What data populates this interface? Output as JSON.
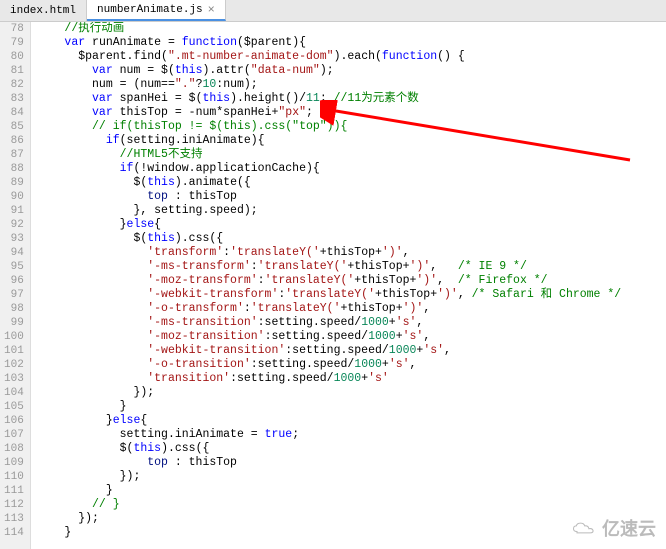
{
  "tabs": {
    "items": [
      {
        "name": "index.html",
        "active": false
      },
      {
        "name": "numberAnimate.js",
        "active": true
      }
    ],
    "close_glyph": "×"
  },
  "line_start": 78,
  "line_end": 114,
  "code_lines": [
    {
      "indent": 2,
      "tokens": [
        [
          "comment",
          "//执行动画"
        ]
      ]
    },
    {
      "indent": 2,
      "tokens": [
        [
          "keyword",
          "var"
        ],
        [
          "ident",
          " runAnimate = "
        ],
        [
          "keyword",
          "function"
        ],
        [
          "punct",
          "($parent){"
        ]
      ]
    },
    {
      "indent": 3,
      "tokens": [
        [
          "ident",
          "$parent.find("
        ],
        [
          "string",
          "\".mt-number-animate-dom\""
        ],
        [
          "punct",
          ").each("
        ],
        [
          "keyword",
          "function"
        ],
        [
          "punct",
          "() {"
        ]
      ]
    },
    {
      "indent": 4,
      "tokens": [
        [
          "keyword",
          "var"
        ],
        [
          "ident",
          " num = $("
        ],
        [
          "keyword",
          "this"
        ],
        [
          "punct",
          ").attr("
        ],
        [
          "string",
          "\"data-num\""
        ],
        [
          "punct",
          ");"
        ]
      ]
    },
    {
      "indent": 4,
      "tokens": [
        [
          "ident",
          "num = (num=="
        ],
        [
          "string",
          "\".\""
        ],
        [
          "punct",
          "?"
        ],
        [
          "number",
          "10"
        ],
        [
          "punct",
          ":num);"
        ]
      ]
    },
    {
      "indent": 4,
      "tokens": [
        [
          "keyword",
          "var"
        ],
        [
          "ident",
          " spanHei = $("
        ],
        [
          "keyword",
          "this"
        ],
        [
          "punct",
          ").height()/"
        ],
        [
          "number",
          "11"
        ],
        [
          "punct",
          "; "
        ],
        [
          "comment",
          "//11为元素个数"
        ]
      ]
    },
    {
      "indent": 4,
      "tokens": [
        [
          "keyword",
          "var"
        ],
        [
          "ident",
          " thisTop = -num*spanHei+"
        ],
        [
          "string",
          "\"px\""
        ],
        [
          "punct",
          ";"
        ]
      ]
    },
    {
      "indent": 4,
      "tokens": [
        [
          "comment",
          "// if(thisTop != $(this).css(\"top\")){"
        ]
      ]
    },
    {
      "indent": 5,
      "tokens": [
        [
          "keyword",
          "if"
        ],
        [
          "punct",
          "(setting.iniAnimate){"
        ]
      ]
    },
    {
      "indent": 6,
      "tokens": [
        [
          "comment",
          "//HTML5不支持"
        ]
      ]
    },
    {
      "indent": 6,
      "tokens": [
        [
          "keyword",
          "if"
        ],
        [
          "punct",
          "(!window.applicationCache){"
        ]
      ]
    },
    {
      "indent": 7,
      "tokens": [
        [
          "ident",
          "$("
        ],
        [
          "keyword",
          "this"
        ],
        [
          "punct",
          ").animate({"
        ]
      ]
    },
    {
      "indent": 8,
      "tokens": [
        [
          "prop",
          "top "
        ],
        [
          "punct",
          ": thisTop"
        ]
      ]
    },
    {
      "indent": 7,
      "tokens": [
        [
          "punct",
          "}, setting.speed);"
        ]
      ]
    },
    {
      "indent": 6,
      "tokens": [
        [
          "punct",
          "}"
        ],
        [
          "keyword",
          "else"
        ],
        [
          "punct",
          "{"
        ]
      ]
    },
    {
      "indent": 7,
      "tokens": [
        [
          "ident",
          "$("
        ],
        [
          "keyword",
          "this"
        ],
        [
          "punct",
          ").css({"
        ]
      ]
    },
    {
      "indent": 8,
      "tokens": [
        [
          "string",
          "'transform'"
        ],
        [
          "punct",
          ":"
        ],
        [
          "string",
          "'translateY('"
        ],
        [
          "punct",
          "+thisTop+"
        ],
        [
          "string",
          "')'"
        ],
        [
          "punct",
          ","
        ]
      ]
    },
    {
      "indent": 8,
      "tokens": [
        [
          "string",
          "'-ms-transform'"
        ],
        [
          "punct",
          ":"
        ],
        [
          "string",
          "'translateY('"
        ],
        [
          "punct",
          "+thisTop+"
        ],
        [
          "string",
          "')'"
        ],
        [
          "punct",
          ",   "
        ],
        [
          "comment",
          "/* IE 9 */"
        ]
      ]
    },
    {
      "indent": 8,
      "tokens": [
        [
          "string",
          "'-moz-transform'"
        ],
        [
          "punct",
          ":"
        ],
        [
          "string",
          "'translateY('"
        ],
        [
          "punct",
          "+thisTop+"
        ],
        [
          "string",
          "')'"
        ],
        [
          "punct",
          ",  "
        ],
        [
          "comment",
          "/* Firefox */"
        ]
      ]
    },
    {
      "indent": 8,
      "tokens": [
        [
          "string",
          "'-webkit-transform'"
        ],
        [
          "punct",
          ":"
        ],
        [
          "string",
          "'translateY('"
        ],
        [
          "punct",
          "+thisTop+"
        ],
        [
          "string",
          "')'"
        ],
        [
          "punct",
          ", "
        ],
        [
          "comment",
          "/* Safari 和 Chrome */"
        ]
      ]
    },
    {
      "indent": 8,
      "tokens": [
        [
          "string",
          "'-o-transform'"
        ],
        [
          "punct",
          ":"
        ],
        [
          "string",
          "'translateY('"
        ],
        [
          "punct",
          "+thisTop+"
        ],
        [
          "string",
          "')'"
        ],
        [
          "punct",
          ","
        ]
      ]
    },
    {
      "indent": 8,
      "tokens": [
        [
          "string",
          "'-ms-transition'"
        ],
        [
          "punct",
          ":setting.speed/"
        ],
        [
          "number",
          "1000"
        ],
        [
          "punct",
          "+"
        ],
        [
          "string",
          "'s'"
        ],
        [
          "punct",
          ","
        ]
      ]
    },
    {
      "indent": 8,
      "tokens": [
        [
          "string",
          "'-moz-transition'"
        ],
        [
          "punct",
          ":setting.speed/"
        ],
        [
          "number",
          "1000"
        ],
        [
          "punct",
          "+"
        ],
        [
          "string",
          "'s'"
        ],
        [
          "punct",
          ","
        ]
      ]
    },
    {
      "indent": 8,
      "tokens": [
        [
          "string",
          "'-webkit-transition'"
        ],
        [
          "punct",
          ":setting.speed/"
        ],
        [
          "number",
          "1000"
        ],
        [
          "punct",
          "+"
        ],
        [
          "string",
          "'s'"
        ],
        [
          "punct",
          ","
        ]
      ]
    },
    {
      "indent": 8,
      "tokens": [
        [
          "string",
          "'-o-transition'"
        ],
        [
          "punct",
          ":setting.speed/"
        ],
        [
          "number",
          "1000"
        ],
        [
          "punct",
          "+"
        ],
        [
          "string",
          "'s'"
        ],
        [
          "punct",
          ","
        ]
      ]
    },
    {
      "indent": 8,
      "tokens": [
        [
          "string",
          "'transition'"
        ],
        [
          "punct",
          ":setting.speed/"
        ],
        [
          "number",
          "1000"
        ],
        [
          "punct",
          "+"
        ],
        [
          "string",
          "'s'"
        ]
      ]
    },
    {
      "indent": 7,
      "tokens": [
        [
          "punct",
          "});"
        ]
      ]
    },
    {
      "indent": 6,
      "tokens": [
        [
          "punct",
          "}"
        ]
      ]
    },
    {
      "indent": 5,
      "tokens": [
        [
          "punct",
          "}"
        ],
        [
          "keyword",
          "else"
        ],
        [
          "punct",
          "{"
        ]
      ]
    },
    {
      "indent": 6,
      "tokens": [
        [
          "ident",
          "setting.iniAnimate = "
        ],
        [
          "keyword",
          "true"
        ],
        [
          "punct",
          ";"
        ]
      ]
    },
    {
      "indent": 6,
      "tokens": [
        [
          "ident",
          "$("
        ],
        [
          "keyword",
          "this"
        ],
        [
          "punct",
          ").css({"
        ]
      ]
    },
    {
      "indent": 8,
      "tokens": [
        [
          "prop",
          "top "
        ],
        [
          "punct",
          ": thisTop"
        ]
      ]
    },
    {
      "indent": 6,
      "tokens": [
        [
          "punct",
          "});"
        ]
      ]
    },
    {
      "indent": 5,
      "tokens": [
        [
          "punct",
          "}"
        ]
      ]
    },
    {
      "indent": 4,
      "tokens": [
        [
          "comment",
          "// }"
        ]
      ]
    },
    {
      "indent": 3,
      "tokens": [
        [
          "punct",
          "});"
        ]
      ]
    },
    {
      "indent": 2,
      "tokens": [
        [
          "punct",
          "}"
        ]
      ]
    }
  ],
  "watermark": {
    "text": "亿速云"
  }
}
